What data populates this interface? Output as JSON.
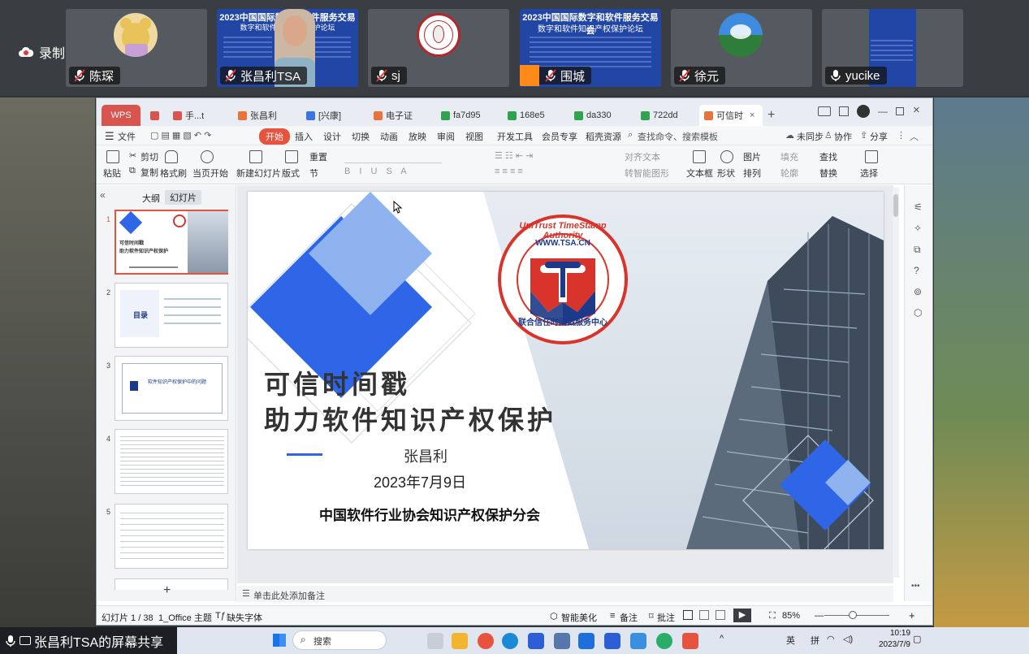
{
  "meeting": {
    "recording_label": "录制中",
    "participants": [
      {
        "name": "陈琛",
        "muted": true
      },
      {
        "name": "张昌利TSA",
        "muted": true
      },
      {
        "name": "sj",
        "muted": true
      },
      {
        "name": "围城",
        "muted": true
      },
      {
        "name": "徐元",
        "muted": true
      },
      {
        "name": "yucike",
        "muted": false
      }
    ],
    "poster_title": "2023中国国际数字和软件服务交易会",
    "poster_subtitle": "数字和软件知识产权保护论坛",
    "more_label": "•••",
    "share_label": "张昌利TSA的屏幕共享"
  },
  "wps": {
    "tabs": [
      "WPS",
      "手...t",
      "张昌利",
      "[兴康]",
      "电子证",
      "fa7d95",
      "168e5",
      "da330",
      "722dd",
      "可信时"
    ],
    "menu": [
      "文件",
      "开始",
      "插入",
      "设计",
      "切换",
      "动画",
      "放映",
      "审阅",
      "视图",
      "开发工具",
      "会员专享",
      "稻壳资源"
    ],
    "search_placeholder": "查找命令、搜索模板",
    "sync_label": "未同步",
    "collab_label": "协作",
    "share_label": "分享",
    "ribbon": {
      "paste": "粘贴",
      "cut": "剪切",
      "copy": "复制",
      "format_painter": "格式刷",
      "start_from_current": "当页开始",
      "new_slide": "新建幻灯片",
      "layout": "版式",
      "section": "节",
      "reset": "重置",
      "text_box": "文本框",
      "shape": "形状",
      "picture": "图片",
      "arrange": "排列",
      "fill": "填充",
      "outline": "轮廓",
      "find": "查找",
      "replace": "替换",
      "select": "选择",
      "align_text": "对齐文本",
      "smart_shape": "转智能图形"
    },
    "pane_tabs": [
      "大纲",
      "幻灯片"
    ],
    "thumb2_title": "目录",
    "thumb3_title": "软件知识产权保护中的问题",
    "notes_placeholder": "单击此处添加备注",
    "status": {
      "slide_count": "幻灯片 1 / 38",
      "theme": "1_Office 主题",
      "missing_font": "缺失字体",
      "beautify": "智能美化",
      "notes": "备注",
      "comments": "批注",
      "zoom": "85%"
    }
  },
  "slide": {
    "title_line1": "可信时间戳",
    "title_line2": "助力软件知识产权保护",
    "author": "张昌利",
    "date": "2023年7月9日",
    "org": "中国软件行业协会知识产权保护分会",
    "logo_ring_text": "UniTrust TimeStamp Authority",
    "logo_url": "WWW.TSA.CN",
    "logo_bottom_text": "联合信任时间戳服务中心",
    "colors": {
      "blue": "#2f66e8",
      "light_blue": "#8fb3ee",
      "red": "#d9342b",
      "navy": "#1d3a8a"
    }
  },
  "taskbar": {
    "search_label": "搜索",
    "ime_label": "英",
    "ime2_label": "拼",
    "time": "10:19",
    "date": "2023/7/9"
  }
}
